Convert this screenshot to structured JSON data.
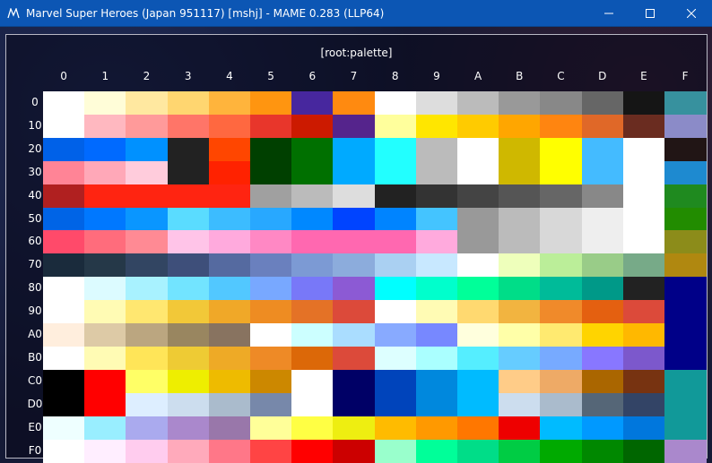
{
  "window": {
    "title": "Marvel Super Heroes (Japan 951117) [mshj] - MAME 0.283 (LLP64)",
    "controls": {
      "minimize": "minimize",
      "maximize": "maximize",
      "close": "close"
    }
  },
  "panel": {
    "title": "[root:palette]"
  },
  "columns": [
    "0",
    "1",
    "2",
    "3",
    "4",
    "5",
    "6",
    "7",
    "8",
    "9",
    "A",
    "B",
    "C",
    "D",
    "E",
    "F"
  ],
  "rows": [
    {
      "label": "0",
      "colors": [
        "#ffffff",
        "#fffdd8",
        "#ffe8a0",
        "#ffd670",
        "#ffb43c",
        "#ff9510",
        "#47279e",
        "#ff8a10",
        "#ffffff",
        "#dddddd",
        "#bbbbbb",
        "#999999",
        "#888888",
        "#666666",
        "#151515",
        "#37919e"
      ]
    },
    {
      "label": "10",
      "colors": [
        "#ffffff",
        "#ffb8c0",
        "#ff9a9a",
        "#ff7568",
        "#ff6840",
        "#e8362b",
        "#cc1a00",
        "#55248c",
        "#ffff9c",
        "#ffe600",
        "#ffcb00",
        "#ffa600",
        "#ff8510",
        "#e06828",
        "#6a2c20",
        "#8b8bc8"
      ]
    },
    {
      "label": "20",
      "colors": [
        "#0061e8",
        "#006aff",
        "#0091ff",
        "#222222",
        "#ff4600",
        "#004000",
        "#007000",
        "#00aaff",
        "#22ffff",
        "#bbbbbb",
        "#ffffff",
        "#cfb800",
        "#ffff00",
        "#44bbff",
        "#ffffff",
        "#211515"
      ]
    },
    {
      "label": "30",
      "colors": [
        "#ff8496",
        "#ffa8b8",
        "#ffccdc",
        "#222222",
        "#ff2200",
        "#004000",
        "#007000",
        "#00aaff",
        "#22ffff",
        "#bbbbbb",
        "#ffffff",
        "#cfb800",
        "#ffff00",
        "#44bbff",
        "#ffffff",
        "#1e8ad0"
      ]
    },
    {
      "label": "40",
      "colors": [
        "#b02020",
        "#ff2411",
        "#ff2411",
        "#ff2411",
        "#ff2411",
        "#a0a0a0",
        "#bbbbbb",
        "#dddddd",
        "#222222",
        "#333333",
        "#444444",
        "#555555",
        "#666666",
        "#888888",
        "#ffffff",
        "#1f8a1f"
      ]
    },
    {
      "label": "50",
      "colors": [
        "#0064e6",
        "#0078ff",
        "#0a96ff",
        "#5adcff",
        "#3cbcff",
        "#28a8ff",
        "#0088ff",
        "#0044ff",
        "#0084ff",
        "#44c4ff",
        "#999999",
        "#bbbbbb",
        "#d8d8d8",
        "#eeeeee",
        "#ffffff",
        "#228c00"
      ]
    },
    {
      "label": "60",
      "colors": [
        "#ff4a6a",
        "#ff6c7c",
        "#ff8a94",
        "#ffc4e8",
        "#ffaadd",
        "#ff88c4",
        "#ff68b0",
        "#ff68b0",
        "#ff68b0",
        "#ffaadd",
        "#999999",
        "#bbbbbb",
        "#d8d8d8",
        "#eeeeee",
        "#ffffff",
        "#8c8c1a"
      ]
    },
    {
      "label": "70",
      "colors": [
        "#1a2b3c",
        "#253848",
        "#324562",
        "#3e4f7a",
        "#556aa0",
        "#6a80be",
        "#7c9ad4",
        "#8cacdc",
        "#aad0f2",
        "#c8e8ff",
        "#ffffff",
        "#eeffbb",
        "#bbee99",
        "#99cc88",
        "#77aa88",
        "#b08810"
      ]
    },
    {
      "label": "80",
      "colors": [
        "#ffffff",
        "#dcfbff",
        "#a8f2ff",
        "#72e4ff",
        "#52c8ff",
        "#78a8ff",
        "#7878f8",
        "#8c5ad4",
        "#00ffff",
        "#00ffcc",
        "#00ff99",
        "#00dd88",
        "#00bb99",
        "#009988",
        "#222222",
        "#000088"
      ]
    },
    {
      "label": "90",
      "colors": [
        "#ffffff",
        "#fffbb4",
        "#ffe770",
        "#f2c838",
        "#f0a828",
        "#ee8c22",
        "#e47226",
        "#dc4a3a",
        "#ffffff",
        "#fffbb4",
        "#ffd970",
        "#f2b440",
        "#f08a2a",
        "#e46010",
        "#dc4a3a",
        "#000088"
      ]
    },
    {
      "label": "A0",
      "colors": [
        "#ffeedd",
        "#ddcaa6",
        "#bba680",
        "#998660",
        "#887360",
        "#ffffff",
        "#ccffff",
        "#aaddff",
        "#88aaff",
        "#7788ff",
        "#ffffdd",
        "#ffffa8",
        "#ffea70",
        "#ffd400",
        "#ffb800",
        "#000088"
      ]
    },
    {
      "label": "B0",
      "colors": [
        "#ffffff",
        "#fffbb4",
        "#ffe558",
        "#eecb34",
        "#eeaa26",
        "#ee8a26",
        "#dc6808",
        "#dc4a3a",
        "#ddffff",
        "#aaffff",
        "#55eeff",
        "#66ccff",
        "#77aaff",
        "#8877ff",
        "#7c58cc",
        "#000088"
      ]
    },
    {
      "label": "C0",
      "colors": [
        "#000000",
        "#ff0000",
        "#ffff66",
        "#eeee00",
        "#eebb00",
        "#cc8800",
        "#ffffff",
        "#000066",
        "#0044bb",
        "#0088dd",
        "#00bbff",
        "#ffcc88",
        "#eeaa66",
        "#aa6600",
        "#773311",
        "#119999"
      ]
    },
    {
      "label": "D0",
      "colors": [
        "#000000",
        "#ff0000",
        "#ddeeff",
        "#ccddee",
        "#aabbcc",
        "#7788aa",
        "#ffffff",
        "#000066",
        "#0044bb",
        "#0088dd",
        "#00bbff",
        "#ccddee",
        "#aabbcc",
        "#556677",
        "#334466",
        "#119999"
      ]
    },
    {
      "label": "E0",
      "colors": [
        "#eeffff",
        "#99eeff",
        "#aaaaee",
        "#aa88cc",
        "#9977aa",
        "#ffff99",
        "#ffff44",
        "#eeee11",
        "#ffbb00",
        "#ff9900",
        "#ff7700",
        "#ee0000",
        "#00bbff",
        "#0099ff",
        "#0077dd",
        "#119999"
      ]
    },
    {
      "label": "F0",
      "colors": [
        "#ffffff",
        "#ffeeff",
        "#ffccee",
        "#ffaabb",
        "#ff7788",
        "#ff4444",
        "#ff0000",
        "#cc0000",
        "#99ffcc",
        "#00ff99",
        "#00dd88",
        "#00cc44",
        "#00aa00",
        "#008800",
        "#006600",
        "#aa88cc"
      ]
    }
  ]
}
